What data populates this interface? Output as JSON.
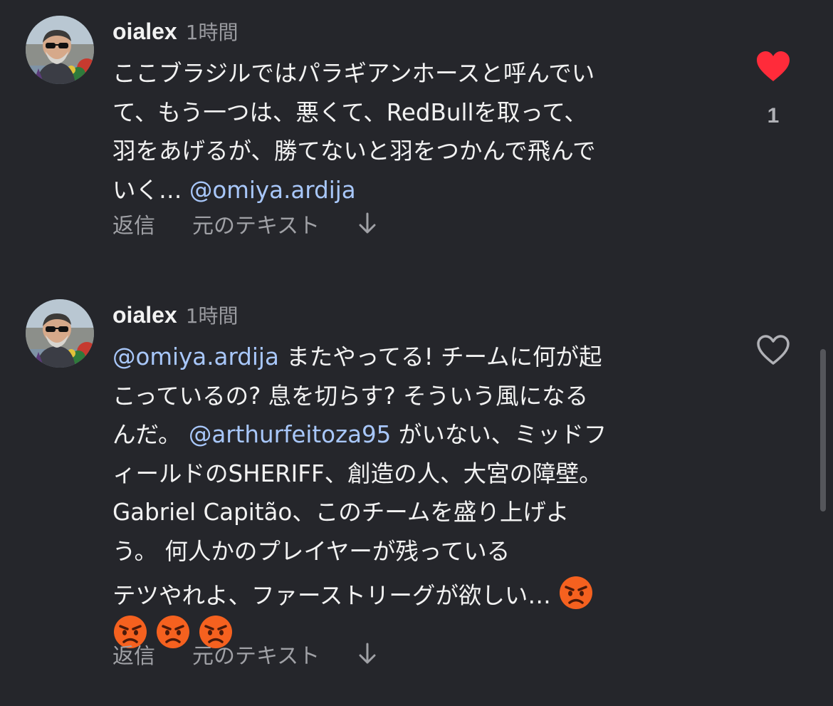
{
  "comments": [
    {
      "username": "oialex",
      "timestamp": "1時間",
      "lines": [
        [
          {
            "text": "ここブラジルではパラギアンホースと呼んでい"
          }
        ],
        [
          {
            "text": "て、もう一つは、悪くて、RedBullを取って、"
          }
        ],
        [
          {
            "text": "羽をあげるが、勝てないと羽をつかんで飛んで"
          }
        ],
        [
          {
            "text": "いく… "
          },
          {
            "text": "@omiya.ardija",
            "mention": true
          }
        ]
      ],
      "reply_label": "返信",
      "original_text_label": "元のテキスト",
      "liked": true,
      "like_count": "1"
    },
    {
      "username": "oialex",
      "timestamp": "1時間",
      "lines": [
        [
          {
            "text": "@omiya.ardija",
            "mention": true
          },
          {
            "text": " またやってる! チームに何が起"
          }
        ],
        [
          {
            "text": "こっているの? 息を切らす? そういう風になる"
          }
        ],
        [
          {
            "text": "んだ。 "
          },
          {
            "text": "@arthurfeitoza95",
            "mention": true
          },
          {
            "text": " がいない、ミッドフ"
          }
        ],
        [
          {
            "text": "ィールドのSHERIFF、創造の人、大宮の障壁。"
          }
        ],
        [
          {
            "text": "Gabriel Capitão、このチームを盛り上げよ"
          }
        ],
        [
          {
            "text": "う。 何人かのプレイヤーが残っている"
          }
        ],
        [
          {
            "text": "テツやれよ、ファーストリーグが欲しい… "
          },
          {
            "emoji": "angry-face"
          }
        ],
        [
          {
            "emoji": "angry-face"
          },
          {
            "emoji": "angry-face"
          },
          {
            "emoji": "angry-face"
          }
        ]
      ],
      "reply_label": "返信",
      "original_text_label": "元のテキスト",
      "liked": false,
      "like_count": ""
    }
  ],
  "colors": {
    "background": "#25262b",
    "mention": "#a8c7fa",
    "heart_liked": "#ff2b3a",
    "secondary_text": "#a0a1a6"
  },
  "icons": {
    "like_filled": "heart-filled-icon",
    "like_outline": "heart-outline-icon",
    "translate_toggle": "arrow-down-icon",
    "emoji": "angry-face-emoji"
  }
}
